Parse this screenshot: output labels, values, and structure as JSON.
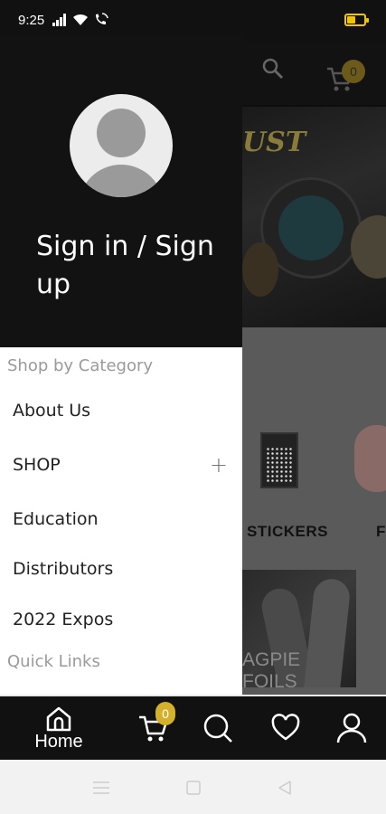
{
  "status_bar": {
    "time": "9:25",
    "icons": [
      "signal-icon",
      "wifi-icon",
      "wifi-calling-icon",
      "battery-icon"
    ],
    "battery_color": "#f2c500"
  },
  "header": {
    "cart_count": "0",
    "icons": [
      "search-icon",
      "cart-icon"
    ]
  },
  "background": {
    "banner_text": "UST",
    "category_labels": [
      "STICKERS",
      "F"
    ],
    "foils_label": "AGPIE FOILS"
  },
  "drawer": {
    "signin_label": "Sign in / Sign up",
    "section_shop": "Shop by Category",
    "items": [
      {
        "label": "About Us"
      },
      {
        "label": "SHOP",
        "expand": "+"
      },
      {
        "label": "Education"
      },
      {
        "label": "Distributors"
      },
      {
        "label": "2022 Expos"
      }
    ],
    "section_quick": "Quick Links"
  },
  "bottom_nav": {
    "home_label": "Home",
    "cart_count": "0",
    "icons": [
      "home-icon",
      "cart-icon",
      "search-icon",
      "heart-icon",
      "user-icon"
    ],
    "badge_color": "#d4b12a"
  },
  "system_nav": {
    "icons": [
      "menu-icon",
      "home-square-icon",
      "back-icon"
    ]
  }
}
